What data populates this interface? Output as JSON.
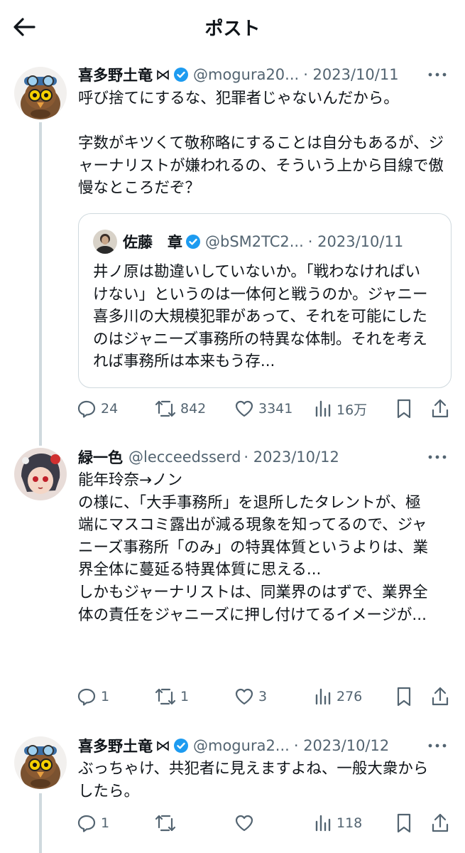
{
  "header": {
    "title": "ポスト"
  },
  "tweet1": {
    "name": "喜多野土竜",
    "name_mark": "⋈",
    "handle": "@mogura20...",
    "date": "· 2023/10/11",
    "text": "呼び捨てにするな、犯罪者じゃないんだから。\n\n字数がキツくて敬称略にすることは自分もあるが、ジャーナリストが嫌われるの、そういう上から目線で傲慢なところだぞ？",
    "quote": {
      "name": "佐藤　章",
      "handle": "@bSM2TC2...",
      "date": "· 2023/10/11",
      "text": "井ノ原は勘違いしていないか。「戦わなければいけない」というのは一体何と戦うのか。ジャニー喜多川の大規模犯罪があって、それを可能にしたのはジャニーズ事務所の特異な体制。それを考えれば事務所は本来もう存..."
    },
    "replies": "24",
    "reposts": "842",
    "likes": "3341",
    "views": "16万"
  },
  "tweet2": {
    "name": "緑一色",
    "handle": "@lecceedsserd",
    "date": "· 2023/10/12",
    "text": "能年玲奈→ノン\nの様に、「大手事務所」を退所したタレントが、極端にマスコミ露出が減る現象を知ってるので、ジャニーズ事務所「のみ」の特異体質というよりは、業界全体に蔓延る特異体質に思える...\nしかもジャーナリストは、同業界のはずで、業界全体の責任をジャニーズに押し付けてるイメージが...",
    "replies": "1",
    "reposts": "1",
    "likes": "3",
    "views": "276"
  },
  "tweet3": {
    "name": "喜多野土竜",
    "name_mark": "⋈",
    "handle": "@mogura2...",
    "date": "· 2023/10/12",
    "text": "ぶっちゃけ、共犯者に見えますよね、一般大衆からしたら。",
    "replies": "1",
    "views": "118"
  },
  "colors": {
    "verified": "#1d9bf0",
    "muted": "#536471",
    "border": "#cfd9de"
  }
}
